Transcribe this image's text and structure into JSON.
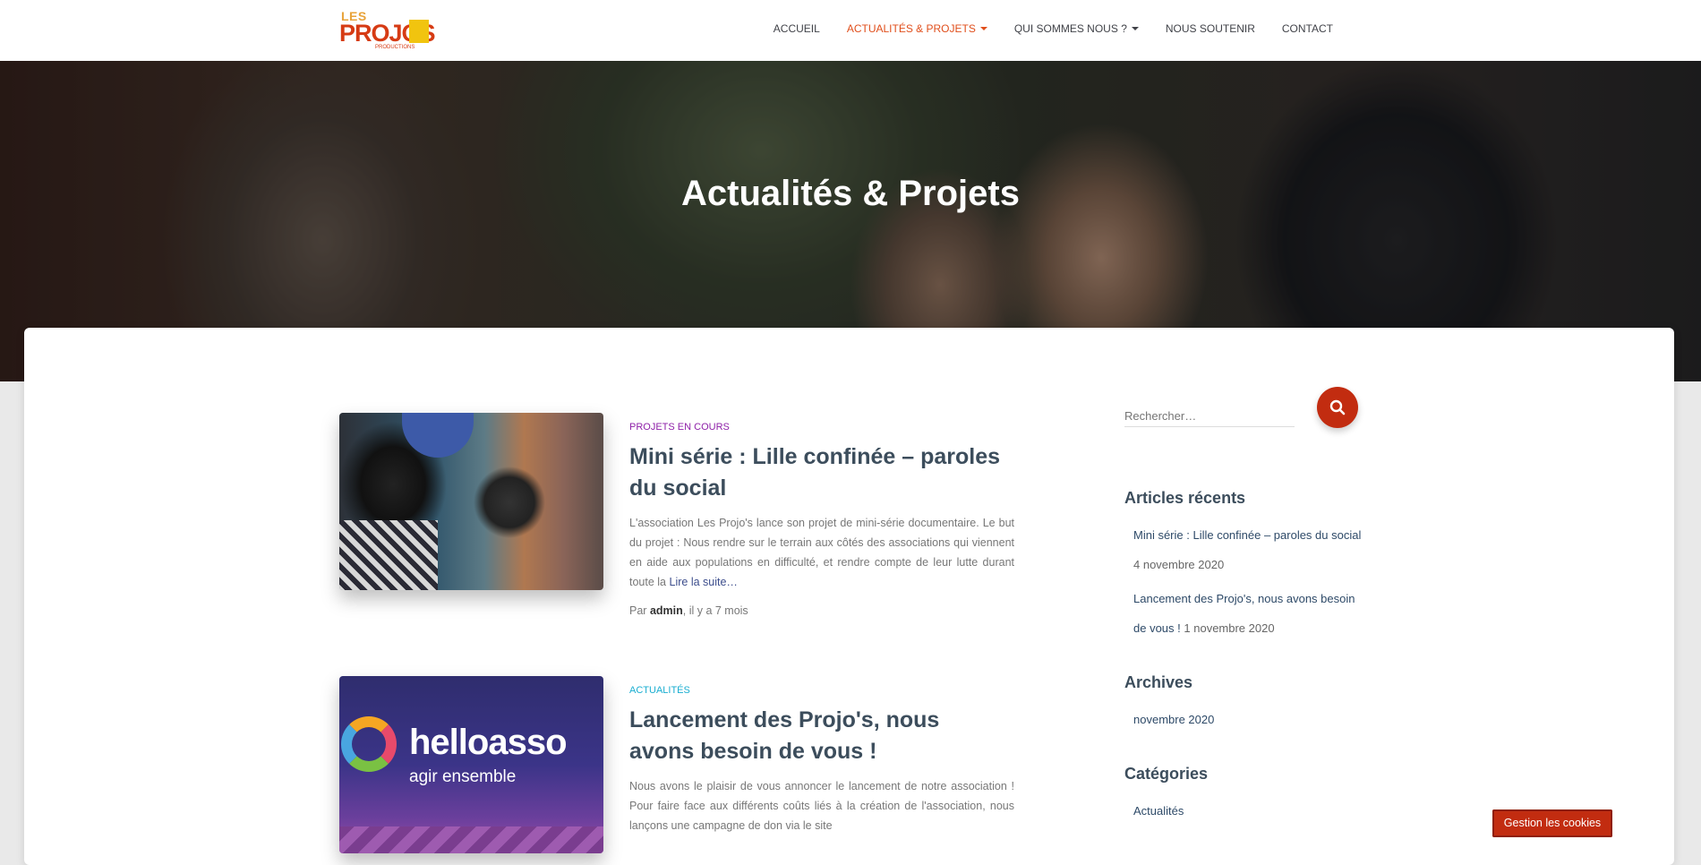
{
  "logo": {
    "les": "LES",
    "projos": "PROJOS",
    "tagline": "PRODUCTIONS"
  },
  "nav": {
    "items": [
      {
        "label": "ACCUEIL",
        "active": false,
        "dropdown": false
      },
      {
        "label": "ACTUALITÉS & PROJETS",
        "active": true,
        "dropdown": true
      },
      {
        "label": "QUI SOMMES NOUS ?",
        "active": false,
        "dropdown": true
      },
      {
        "label": "NOUS SOUTENIR",
        "active": false,
        "dropdown": false
      },
      {
        "label": "CONTACT",
        "active": false,
        "dropdown": false
      }
    ]
  },
  "hero": {
    "title": "Actualités & Projets"
  },
  "posts": [
    {
      "category": "PROJETS EN COURS",
      "category_color": "#8e1fa8",
      "title": "Mini série : Lille confinée – paroles du social",
      "excerpt": "L'association Les Projo's lance son projet de mini-série documentaire. Le but du projet : Nous rendre sur le terrain aux côtés des associations qui viennent en aide aux populations en difficulté, et rendre compte de leur lutte durant toute la",
      "read_more": "Lire la suite…",
      "by": "Par",
      "author": "admin",
      "ago": ", il y a 7 mois"
    },
    {
      "category": "ACTUALITÉS",
      "category_color": "#1aaed1",
      "title": "Lancement des Projo's, nous avons besoin de vous !",
      "excerpt": "Nous avons le plaisir de vous annoncer le lancement de notre association ! Pour faire face aux différents coûts liés à la création de l'association, nous lançons une campagne de don via le site",
      "thumb_word": "helloasso",
      "thumb_tag": "agir ensemble"
    }
  ],
  "sidebar": {
    "search_placeholder": "Rechercher…",
    "recent_title": "Articles récents",
    "recent": [
      {
        "title": "Mini série : Lille confinée – paroles du social",
        "date": "4 novembre 2020"
      },
      {
        "title": "Lancement des Projo's, nous avons besoin de vous !",
        "date": "1 novembre 2020"
      }
    ],
    "archives_title": "Archives",
    "archives": [
      "novembre 2020"
    ],
    "categories_title": "Catégories",
    "categories": [
      "Actualités"
    ]
  },
  "cookie_button": "Gestion les cookies",
  "colors": {
    "accent": "#e04e1b",
    "button": "#c22c10"
  }
}
